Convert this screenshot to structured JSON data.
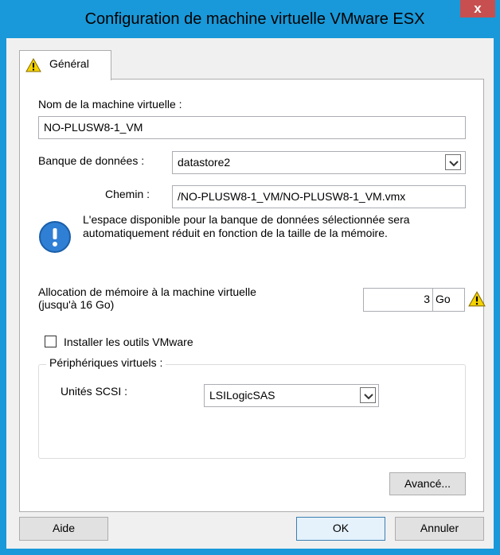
{
  "window": {
    "title": "Configuration de machine virtuelle VMware ESX",
    "close_glyph": "x"
  },
  "tabs": [
    {
      "label": "Général",
      "icon": "warning-icon"
    }
  ],
  "vm_name": {
    "label": "Nom de la machine virtuelle :",
    "value": "NO-PLUSW8-1_VM"
  },
  "datastore": {
    "label": "Banque de données :",
    "value": "datastore2"
  },
  "path": {
    "label": "Chemin :",
    "value": "/NO-PLUSW8-1_VM/NO-PLUSW8-1_VM.vmx"
  },
  "info": {
    "icon": "info-icon",
    "text": "L'espace disponible pour la banque de données sélectionnée sera automatiquement réduit en fonction de la taille de la mémoire."
  },
  "memory": {
    "label_line1": "Allocation de mémoire à la machine virtuelle",
    "label_line2": "(jusqu'à 16 Go)",
    "value": "3",
    "unit": "Go",
    "warning_icon": "warning-icon"
  },
  "vmware_tools": {
    "label": "Installer les outils VMware",
    "checked": false
  },
  "virtual_devices": {
    "legend": "Périphériques virtuels :",
    "scsi_label": "Unités SCSI :",
    "scsi_value": "LSILogicSAS"
  },
  "buttons": {
    "advanced": "Avancé...",
    "help": "Aide",
    "ok": "OK",
    "cancel": "Annuler"
  },
  "colors": {
    "titlebar": "#1999d9",
    "close": "#c74f4f",
    "info": "#2f7fd5",
    "warning": "#f5d300"
  }
}
